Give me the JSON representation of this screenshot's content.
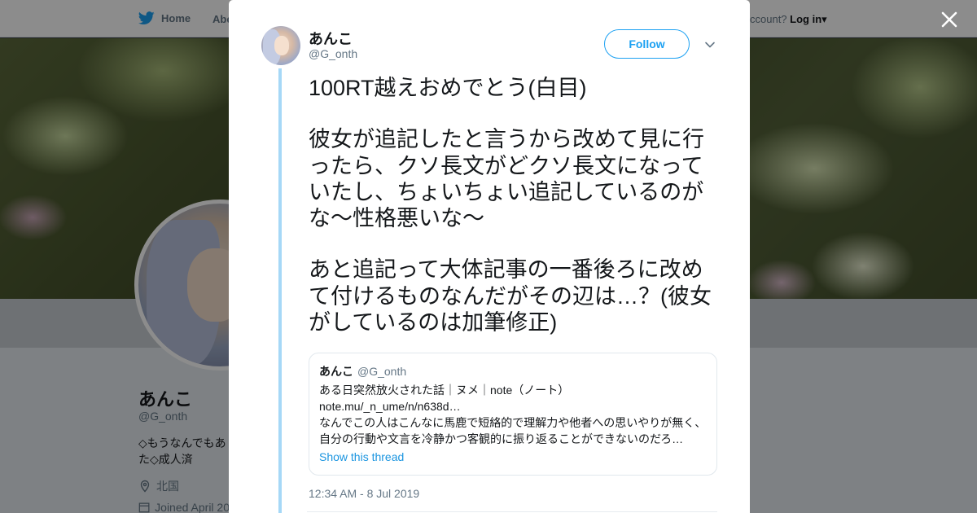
{
  "background": {
    "nav": {
      "home_label": "Home",
      "about_label": "Abo",
      "account_prompt": "ccount?",
      "login_label": "Log in"
    },
    "profile": {
      "name": "あんこ",
      "handle": "@G_onth",
      "bio_line1": "◇もうなんでもあ",
      "bio_line2": "た◇成人済",
      "location": "北国",
      "joined": "Joined April 20"
    }
  },
  "tweet": {
    "author_name": "あんこ",
    "author_handle": "@G_onth",
    "follow_label": "Follow",
    "paragraphs": [
      "100RT越えおめでとう(白目)",
      "彼女が追記したと言うから改めて見に行ったら、クソ長文がどクソ長文になっていたし、ちょいちょい追記しているのがな〜性格悪いな〜",
      "あと追記って大体記事の一番後ろに改めて付けるものなんだがその辺は…？(彼女がしているのは加筆修正)"
    ],
    "quote": {
      "name": "あんこ",
      "handle": "@G_onth",
      "lines": [
        "ある日突然放火された話｜ヌメ｜note（ノート）",
        "note.mu/_n_ume/n/n638d…",
        "なんでこの人はこんなに馬鹿で短絡的で理解力や他者への思いやりが無く、",
        "自分の行動や文言を冷静かつ客観的に振り返ることができないのだろ…"
      ],
      "show_thread_label": "Show this thread"
    },
    "timestamp": "12:34 AM - 8 Jul 2019"
  },
  "colors": {
    "accent": "#1da1f2",
    "thread_line": "#a6d8f7",
    "secondary_text": "#657786",
    "link": "#1b95e0"
  },
  "icons": [
    "twitter-bird-icon",
    "close-icon",
    "chevron-down-icon",
    "location-pin-icon",
    "calendar-icon"
  ]
}
